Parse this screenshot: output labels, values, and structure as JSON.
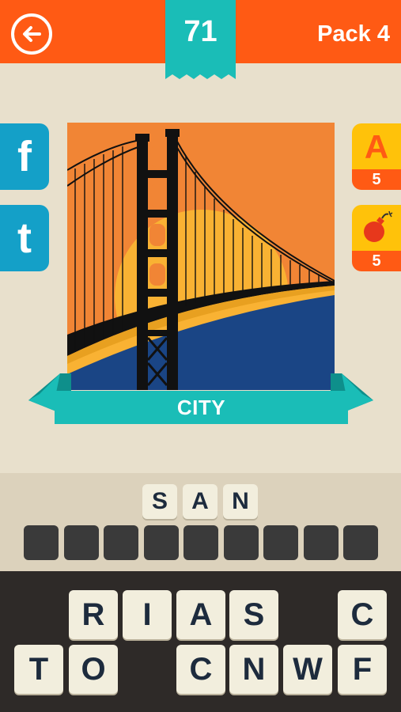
{
  "header": {
    "level_number": "71",
    "pack_label": "Pack 4"
  },
  "colors": {
    "header_orange": "#ff5a14",
    "teal": "#1abdb7",
    "share_blue": "#14a0c8",
    "hint_yellow": "#ffc20a",
    "background": "#e8e0cc",
    "keyboard_dark": "#2e2a28"
  },
  "share": {
    "facebook_label": "f",
    "twitter_label": "t"
  },
  "hints": {
    "reveal_letter_label": "A",
    "reveal_letter_count": "5",
    "bomb_count": "5",
    "bomb_icon": "bomb-icon"
  },
  "puzzle": {
    "image": "golden-gate-bridge-illustration",
    "category": "CITY"
  },
  "answer": {
    "word1_letters": [
      "S",
      "A",
      "N"
    ],
    "word2_slots": 9
  },
  "keyboard": {
    "row1": [
      "R",
      "I",
      "A",
      "S",
      "",
      "C"
    ],
    "row2": [
      "T",
      "O",
      "",
      "C",
      "N",
      "W",
      "F"
    ]
  }
}
